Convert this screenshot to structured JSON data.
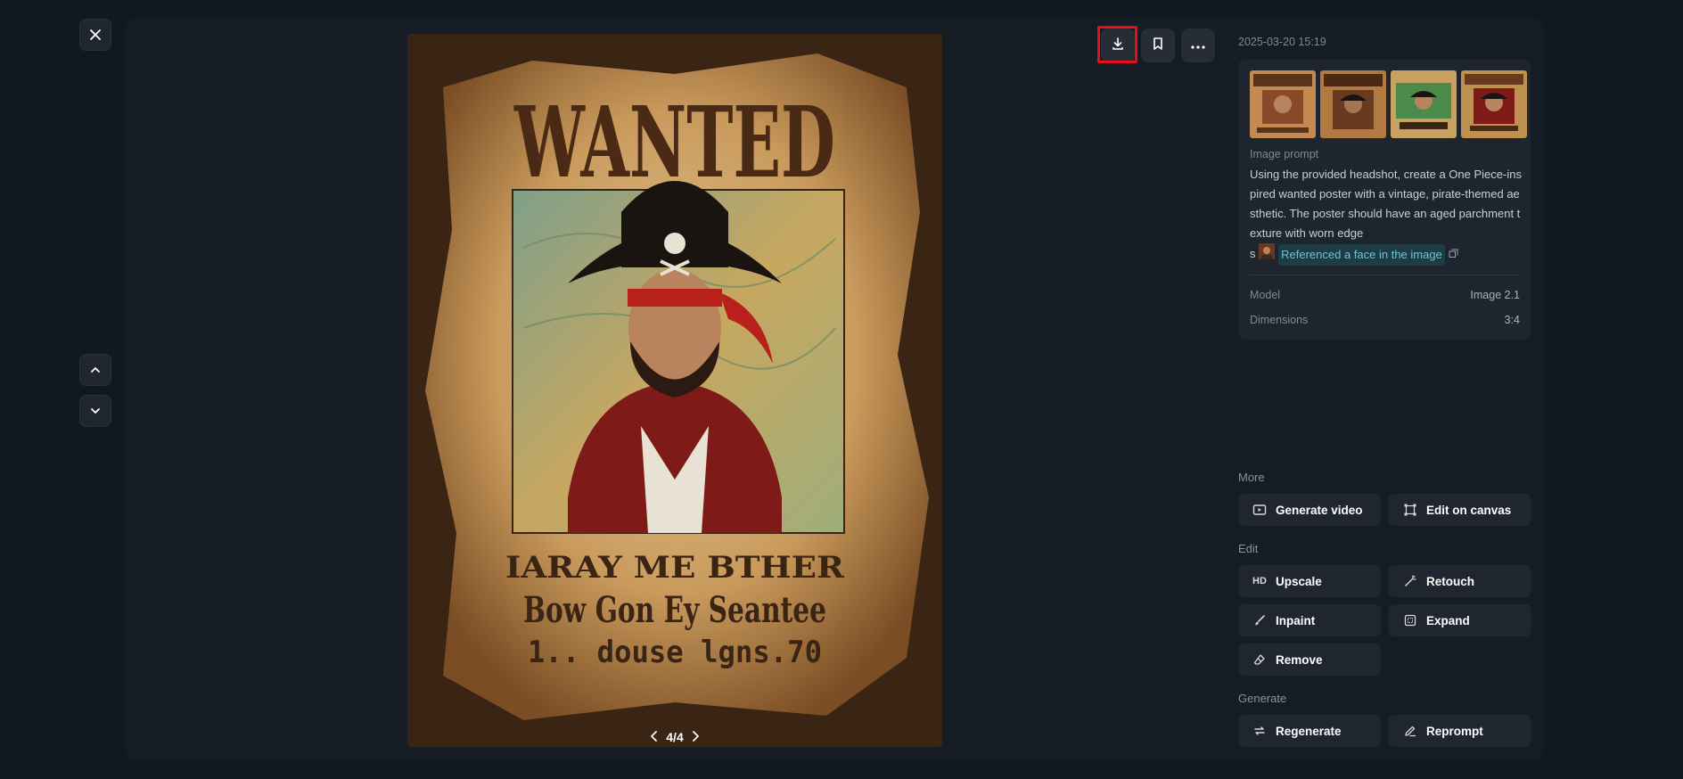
{
  "viewer": {
    "page_indicator": "4/4"
  },
  "poster": {
    "headline": "WANTED",
    "line1": "IARAY ME BTHER",
    "line2": "Bow Gon Ey Seantee",
    "line3": "1.. douse lgns.70"
  },
  "details": {
    "timestamp": "2025-03-20 15:19",
    "prompt_label": "Image prompt",
    "prompt_text": "Using the provided headshot, create a One Piece-inspired wanted poster with a vintage, pirate-themed aesthetic. The poster should have an aged parchment texture with worn edge",
    "prompt_tail": "s",
    "reference_text": "Referenced a face in the image",
    "model_label": "Model",
    "model_value": "Image 2.1",
    "dimensions_label": "Dimensions",
    "dimensions_value": "3:4"
  },
  "sections": {
    "more_label": "More",
    "edit_label": "Edit",
    "generate_label": "Generate"
  },
  "actions": {
    "generate_video": "Generate video",
    "edit_on_canvas": "Edit on canvas",
    "upscale_badge": "HD",
    "upscale": "Upscale",
    "retouch": "Retouch",
    "inpaint": "Inpaint",
    "expand": "Expand",
    "remove": "Remove",
    "regenerate": "Regenerate",
    "reprompt": "Reprompt"
  },
  "colors": {
    "background": "#121820",
    "panel": "#161c24",
    "button": "#1f262f",
    "link": "#69c6d2",
    "highlight": "#e3101b"
  }
}
